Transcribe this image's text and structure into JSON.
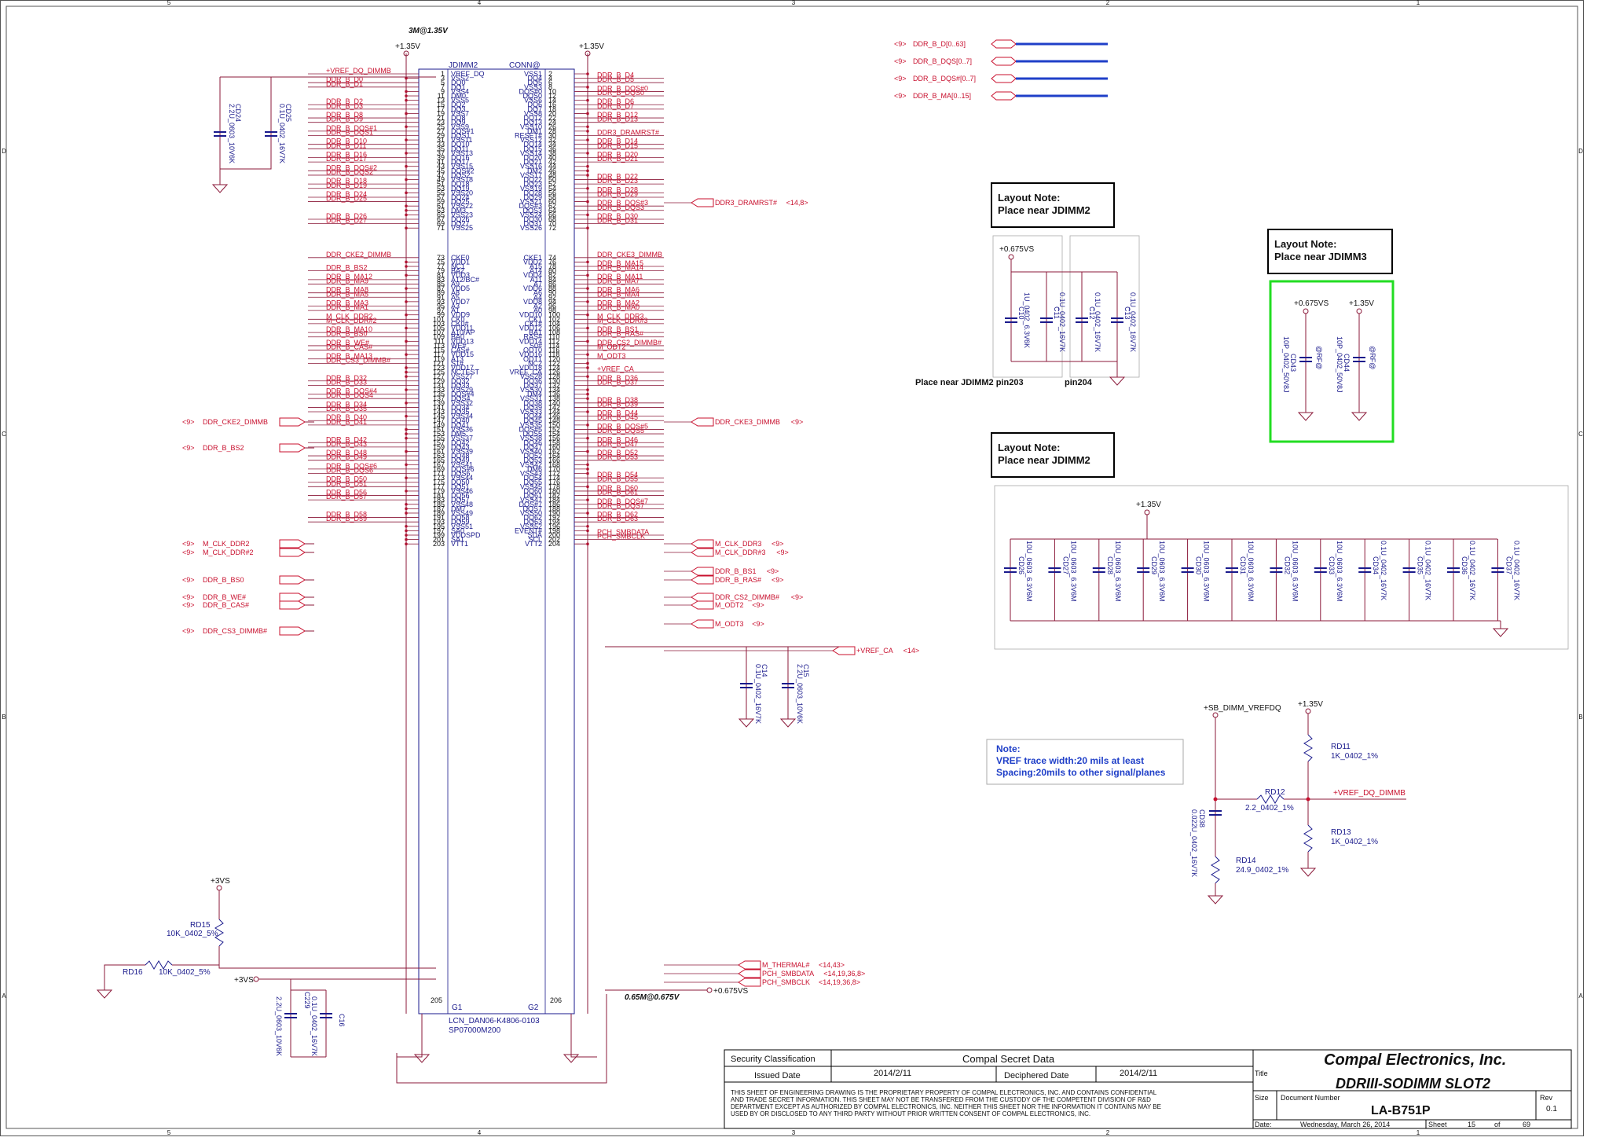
{
  "border": {
    "cols": [
      "5",
      "4",
      "3",
      "2",
      "1"
    ],
    "rows": [
      "D",
      "C",
      "B",
      "A"
    ]
  },
  "header_note": "3M@1.35V",
  "rails": {
    "p135": "+1.35V",
    "p0675vs": "+0.675VS",
    "p3vs": "+3VS",
    "sb_vrefdq": "+SB_DIMM_VREFDQ"
  },
  "connector": {
    "refdes": "JDIMM2",
    "type": "CONN@",
    "pn1": "LCN_DAN06-K4806-0103",
    "pn2": "SP07000M200",
    "g1": "G1",
    "g2": "G2",
    "left_pins": [
      [
        "1",
        "VREF_DQ",
        "+VREF_DQ_DIMMB"
      ],
      [
        "3",
        "VSS2",
        ""
      ],
      [
        "5",
        "DQ0",
        "DDR_B_D0"
      ],
      [
        "7",
        "DQ1",
        "DDR_B_D1"
      ],
      [
        "9",
        "VSS4",
        ""
      ],
      [
        "11",
        "DM0",
        ""
      ],
      [
        "13",
        "VSS5",
        ""
      ],
      [
        "15",
        "DQ2",
        "DDR_B_D2"
      ],
      [
        "17",
        "DQ3",
        "DDR_B_D3"
      ],
      [
        "19",
        "VSS7",
        ""
      ],
      [
        "21",
        "DQ8",
        "DDR_B_D8"
      ],
      [
        "23",
        "DQ9",
        "DDR_B_D9"
      ],
      [
        "25",
        "VSS9",
        ""
      ],
      [
        "27",
        "DQS#1",
        "DDR_B_DQS#1"
      ],
      [
        "29",
        "DQS1",
        "DDR_B_DQS1"
      ],
      [
        "31",
        "VSS11",
        ""
      ],
      [
        "33",
        "DQ10",
        "DDR_B_D10"
      ],
      [
        "35",
        "DQ11",
        "DDR_B_D11"
      ],
      [
        "37",
        "VSS13",
        ""
      ],
      [
        "39",
        "DQ16",
        "DDR_B_D16"
      ],
      [
        "41",
        "DQ17",
        "DDR_B_D17"
      ],
      [
        "43",
        "VSS15",
        ""
      ],
      [
        "45",
        "DQS#2",
        "DDR_B_DQS#2"
      ],
      [
        "47",
        "DQS2",
        "DDR_B_DQS2"
      ],
      [
        "49",
        "VSS18",
        ""
      ],
      [
        "51",
        "DQ18",
        "DDR_B_D18"
      ],
      [
        "53",
        "DQ19",
        "DDR_B_D19"
      ],
      [
        "55",
        "VSS20",
        ""
      ],
      [
        "57",
        "DQ24",
        "DDR_B_D24"
      ],
      [
        "59",
        "DQ25",
        "DDR_B_D25"
      ],
      [
        "61",
        "VSS22",
        ""
      ],
      [
        "63",
        "DM3",
        ""
      ],
      [
        "65",
        "VSS23",
        ""
      ],
      [
        "67",
        "DQ26",
        "DDR_B_D26"
      ],
      [
        "69",
        "DQ27",
        "DDR_B_D27"
      ],
      [
        "71",
        "VSS25",
        ""
      ],
      [
        "73",
        "CKE0",
        "DDR_CKE2_DIMMB"
      ],
      [
        "75",
        "VDD1",
        ""
      ],
      [
        "77",
        "NC1",
        ""
      ],
      [
        "79",
        "BA2",
        "DDR_B_BS2"
      ],
      [
        "81",
        "VDD3",
        ""
      ],
      [
        "83",
        "A12/BC#",
        "DDR_B_MA12"
      ],
      [
        "85",
        "A9",
        "DDR_B_MA9"
      ],
      [
        "87",
        "VDD5",
        ""
      ],
      [
        "89",
        "A8",
        "DDR_B_MA8"
      ],
      [
        "91",
        "A5",
        "DDR_B_MA5"
      ],
      [
        "93",
        "VDD7",
        ""
      ],
      [
        "95",
        "A3",
        "DDR_B_MA3"
      ],
      [
        "97",
        "A1",
        "DDR_B_MA1"
      ],
      [
        "99",
        "VDD9",
        ""
      ],
      [
        "101",
        "CK0",
        "M_CLK_DDR2"
      ],
      [
        "103",
        "CK0#",
        "M_CLK_DDR#2"
      ],
      [
        "105",
        "VDD11",
        ""
      ],
      [
        "107",
        "A10/AP",
        "DDR_B_MA10"
      ],
      [
        "109",
        "BA0",
        "DDR_B_BS0"
      ],
      [
        "111",
        "VDD13",
        ""
      ],
      [
        "113",
        "WE#",
        "DDR_B_WE#"
      ],
      [
        "115",
        "CAS#",
        "DDR_B_CAS#"
      ],
      [
        "117",
        "VDD15",
        ""
      ],
      [
        "119",
        "A13",
        "DDR_B_MA13"
      ],
      [
        "121",
        "S1#",
        "DDR_CS3_DIMMB#"
      ],
      [
        "123",
        "VDD17",
        ""
      ],
      [
        "125",
        "NCTEST",
        ""
      ],
      [
        "127",
        "VSS27",
        ""
      ],
      [
        "129",
        "DQ32",
        "DDR_B_D32"
      ],
      [
        "131",
        "DQ33",
        "DDR_B_D33"
      ],
      [
        "133",
        "VSS29",
        ""
      ],
      [
        "135",
        "DQS#4",
        "DDR_B_DQS#4"
      ],
      [
        "137",
        "DQS4",
        "DDR_B_DQS4"
      ],
      [
        "139",
        "VSS32",
        ""
      ],
      [
        "141",
        "DQ34",
        "DDR_B_D34"
      ],
      [
        "143",
        "DQ35",
        "DDR_B_D35"
      ],
      [
        "145",
        "VSS34",
        ""
      ],
      [
        "147",
        "DQ40",
        "DDR_B_D40"
      ],
      [
        "149",
        "DQ41",
        "DDR_B_D41"
      ],
      [
        "151",
        "VSS36",
        ""
      ],
      [
        "153",
        "DM5",
        ""
      ],
      [
        "155",
        "VSS37",
        ""
      ],
      [
        "157",
        "DQ42",
        "DDR_B_D42"
      ],
      [
        "159",
        "DQ43",
        "DDR_B_D43"
      ],
      [
        "161",
        "VSS39",
        ""
      ],
      [
        "163",
        "DQ48",
        "DDR_B_D48"
      ],
      [
        "165",
        "DQ49",
        "DDR_B_D49"
      ],
      [
        "167",
        "VSS41",
        ""
      ],
      [
        "169",
        "DQS#6",
        "DDR_B_DQS#6"
      ],
      [
        "171",
        "DQS6",
        "DDR_B_DQS6"
      ],
      [
        "173",
        "VSS44",
        ""
      ],
      [
        "175",
        "DQ50",
        "DDR_B_D50"
      ],
      [
        "177",
        "DQ51",
        "DDR_B_D51"
      ],
      [
        "179",
        "VSS46",
        ""
      ],
      [
        "181",
        "DQ56",
        "DDR_B_D56"
      ],
      [
        "183",
        "DQ57",
        "DDR_B_D57"
      ],
      [
        "185",
        "VSS48",
        ""
      ],
      [
        "187",
        "DM7",
        ""
      ],
      [
        "189",
        "VSS49",
        ""
      ],
      [
        "191",
        "DQ58",
        "DDR_B_D58"
      ],
      [
        "193",
        "DQ59",
        "DDR_B_D59"
      ],
      [
        "195",
        "VSS51",
        ""
      ],
      [
        "197",
        "SA0",
        ""
      ],
      [
        "199",
        "VDDSPD",
        ""
      ],
      [
        "201",
        "SA1",
        ""
      ],
      [
        "203",
        "VTT1",
        ""
      ]
    ],
    "right_pins": [
      [
        "2",
        "VSS1",
        ""
      ],
      [
        "4",
        "DQ4",
        "DDR_B_D4"
      ],
      [
        "6",
        "DQ5",
        "DDR_B_D5"
      ],
      [
        "8",
        "VSS3",
        ""
      ],
      [
        "10",
        "DQS#0",
        "DDR_B_DQS#0"
      ],
      [
        "12",
        "DQS0",
        "DDR_B_DQS0"
      ],
      [
        "14",
        "VSS6",
        ""
      ],
      [
        "16",
        "DQ6",
        "DDR_B_D6"
      ],
      [
        "18",
        "DQ7",
        "DDR_B_D7"
      ],
      [
        "20",
        "VSS8",
        ""
      ],
      [
        "22",
        "DQ12",
        "DDR_B_D12"
      ],
      [
        "24",
        "DQ13",
        "DDR_B_D13"
      ],
      [
        "26",
        "VSS10",
        ""
      ],
      [
        "28",
        "DM1",
        ""
      ],
      [
        "30",
        "RESET#",
        "DDR3_DRAMRST#"
      ],
      [
        "32",
        "VSS12",
        ""
      ],
      [
        "34",
        "DQ14",
        "DDR_B_D14"
      ],
      [
        "36",
        "DQ15",
        "DDR_B_D15"
      ],
      [
        "38",
        "VSS14",
        ""
      ],
      [
        "40",
        "DQ20",
        "DDR_B_D20"
      ],
      [
        "42",
        "DQ21",
        "DDR_B_D21"
      ],
      [
        "44",
        "VSS16",
        ""
      ],
      [
        "46",
        "DM2",
        ""
      ],
      [
        "48",
        "VSS17",
        ""
      ],
      [
        "50",
        "DQ22",
        "DDR_B_D22"
      ],
      [
        "52",
        "DQ23",
        "DDR_B_D23"
      ],
      [
        "54",
        "VSS19",
        ""
      ],
      [
        "56",
        "DQ28",
        "DDR_B_D28"
      ],
      [
        "58",
        "DQ29",
        "DDR_B_D29"
      ],
      [
        "60",
        "VSS21",
        ""
      ],
      [
        "62",
        "DQS#3",
        "DDR_B_DQS#3"
      ],
      [
        "64",
        "DQS3",
        "DDR_B_DQS3"
      ],
      [
        "66",
        "VSS24",
        ""
      ],
      [
        "68",
        "DQ30",
        "DDR_B_D30"
      ],
      [
        "70",
        "DQ31",
        "DDR_B_D31"
      ],
      [
        "72",
        "VSS26",
        ""
      ],
      [
        "74",
        "CKE1",
        "DDR_CKE3_DIMMB"
      ],
      [
        "76",
        "VDD2",
        ""
      ],
      [
        "78",
        "A15",
        "DDR_B_MA15"
      ],
      [
        "80",
        "A14",
        "DDR_B_MA14"
      ],
      [
        "82",
        "VDD4",
        ""
      ],
      [
        "84",
        "A11",
        "DDR_B_MA11"
      ],
      [
        "86",
        "A7",
        "DDR_B_MA7"
      ],
      [
        "88",
        "VDD6",
        ""
      ],
      [
        "90",
        "A6",
        "DDR_B_MA6"
      ],
      [
        "92",
        "A4",
        "DDR_B_MA4"
      ],
      [
        "94",
        "VDD8",
        ""
      ],
      [
        "96",
        "A2",
        "DDR_B_MA2"
      ],
      [
        "98",
        "A0",
        "DDR_B_MA0"
      ],
      [
        "100",
        "VDD10",
        ""
      ],
      [
        "102",
        "CK1",
        "M_CLK_DDR3"
      ],
      [
        "104",
        "CK1#",
        "M_CLK_DDR#3"
      ],
      [
        "106",
        "VDD12",
        ""
      ],
      [
        "108",
        "BA1",
        "DDR_B_BS1"
      ],
      [
        "110",
        "RAS#",
        "DDR_B_RAS#"
      ],
      [
        "112",
        "VDD14",
        ""
      ],
      [
        "114",
        "S0#",
        "DDR_CS2_DIMMB#"
      ],
      [
        "116",
        "ODT0",
        "M_ODT2"
      ],
      [
        "118",
        "VDD16",
        ""
      ],
      [
        "120",
        "ODT1",
        "M_ODT3"
      ],
      [
        "122",
        "NC2",
        ""
      ],
      [
        "124",
        "VDD18",
        ""
      ],
      [
        "126",
        "VREF_CA",
        "+VREF_CA"
      ],
      [
        "128",
        "VSS28",
        ""
      ],
      [
        "130",
        "DQ36",
        "DDR_B_D36"
      ],
      [
        "132",
        "DQ37",
        "DDR_B_D37"
      ],
      [
        "134",
        "VSS30",
        ""
      ],
      [
        "136",
        "DM4",
        ""
      ],
      [
        "138",
        "VSS31",
        ""
      ],
      [
        "140",
        "DQ38",
        "DDR_B_D38"
      ],
      [
        "142",
        "DQ39",
        "DDR_B_D39"
      ],
      [
        "144",
        "VSS33",
        ""
      ],
      [
        "146",
        "DQ44",
        "DDR_B_D44"
      ],
      [
        "148",
        "DQ45",
        "DDR_B_D45"
      ],
      [
        "150",
        "VSS35",
        ""
      ],
      [
        "152",
        "DQS#5",
        "DDR_B_DQS#5"
      ],
      [
        "154",
        "DQS5",
        "DDR_B_DQS5"
      ],
      [
        "156",
        "VSS38",
        ""
      ],
      [
        "158",
        "DQ46",
        "DDR_B_D46"
      ],
      [
        "160",
        "DQ47",
        "DDR_B_D47"
      ],
      [
        "162",
        "VSS40",
        ""
      ],
      [
        "164",
        "DQ52",
        "DDR_B_D52"
      ],
      [
        "166",
        "DQ53",
        "DDR_B_D53"
      ],
      [
        "168",
        "VSS42",
        ""
      ],
      [
        "170",
        "DM6",
        ""
      ],
      [
        "172",
        "VSS43",
        ""
      ],
      [
        "174",
        "DQ54",
        "DDR_B_D54"
      ],
      [
        "176",
        "DQ55",
        "DDR_B_D55"
      ],
      [
        "178",
        "VSS45",
        ""
      ],
      [
        "180",
        "DQ60",
        "DDR_B_D60"
      ],
      [
        "182",
        "DQ61",
        "DDR_B_D61"
      ],
      [
        "184",
        "VSS47",
        ""
      ],
      [
        "186",
        "DQS#7",
        "DDR_B_DQS#7"
      ],
      [
        "188",
        "DQS7",
        "DDR_B_DQS7"
      ],
      [
        "190",
        "VSS50",
        ""
      ],
      [
        "192",
        "DQ62",
        "DDR_B_D62"
      ],
      [
        "194",
        "DQ63",
        "DDR_B_D63"
      ],
      [
        "196",
        "VSS52",
        ""
      ],
      [
        "198",
        "EVENT#",
        ""
      ],
      [
        "200",
        "SDA",
        "PCH_SMBDATA"
      ],
      [
        "202",
        "SCL",
        "PCH_SMBCLK"
      ],
      [
        "204",
        "VTT2",
        ""
      ]
    ],
    "pin205": "205",
    "pin206": "206"
  },
  "offpage_left": [
    {
      "ref": "<9>",
      "name": "DDR_CKE2_DIMMB"
    },
    {
      "ref": "<9>",
      "name": "DDR_B_BS2"
    },
    {
      "ref": "<9>",
      "name": "M_CLK_DDR2"
    },
    {
      "ref": "<9>",
      "name": "M_CLK_DDR#2"
    },
    {
      "ref": "<9>",
      "name": "DDR_B_BS0"
    },
    {
      "ref": "<9>",
      "name": "DDR_B_WE#"
    },
    {
      "ref": "<9>",
      "name": "DDR_B_CAS#"
    },
    {
      "ref": "<9>",
      "name": "DDR_CS3_DIMMB#"
    }
  ],
  "offpage_right": [
    {
      "name": "DDR3_DRAMRST#",
      "ref": "<14,8>"
    },
    {
      "name": "DDR_CKE3_DIMMB",
      "ref": "<9>"
    },
    {
      "name": "M_CLK_DDR3",
      "ref": "<9>"
    },
    {
      "name": "M_CLK_DDR#3",
      "ref": "<9>"
    },
    {
      "name": "DDR_B_BS1",
      "ref": "<9>"
    },
    {
      "name": "DDR_B_RAS#",
      "ref": "<9>"
    },
    {
      "name": "DDR_CS2_DIMMB#",
      "ref": "<9>"
    },
    {
      "name": "M_ODT2",
      "ref": "<9>"
    },
    {
      "name": "M_ODT3",
      "ref": "<9>"
    },
    {
      "name": "+VREF_CA",
      "ref": "<14>"
    },
    {
      "name": "M_THERMAL#",
      "ref": "<14,43>"
    },
    {
      "name": "PCH_SMBDATA",
      "ref": "<14,19,36,8>"
    },
    {
      "name": "PCH_SMBCLK",
      "ref": "<14,19,36,8>"
    }
  ],
  "buses": [
    {
      "ref": "<9>",
      "name": "DDR_B_D[0..63]"
    },
    {
      "ref": "<9>",
      "name": "DDR_B_DQS[0..7]"
    },
    {
      "ref": "<9>",
      "name": "DDR_B_DQS#[0..7]"
    },
    {
      "ref": "<9>",
      "name": "DDR_B_MA[0..15]"
    }
  ],
  "caps_vref": [
    {
      "ref": "CD24",
      "val": "2.2U_0603_10V6K"
    },
    {
      "ref": "CD25",
      "val": "0.1U_0402_16V7K"
    }
  ],
  "caps_vrefca": [
    {
      "ref": "C14",
      "val": "0.1U_0402_16V7K"
    },
    {
      "ref": "C15",
      "val": "2.2U_0603_10V6K"
    }
  ],
  "caps_spd": [
    {
      "ref": "C229",
      "val": "2.2U_0603_10V6K"
    },
    {
      "ref": "C16",
      "val": "0.1U_0402_16V7K"
    }
  ],
  "res_spd": {
    "rd15_ref": "RD15",
    "rd15_val": "10K_0402_5%",
    "rd16_ref": "RD16",
    "rd16_val": "10K_0402_5%"
  },
  "vtt_label": "0.65M@0.675V",
  "vtt_rail": "+0.675VS",
  "layout_note1": {
    "line1": "Layout Note:",
    "line2": "Place near JDIMM2"
  },
  "layout_note2": {
    "line1": "Layout Note:",
    "line2": "Place near JDIMM3"
  },
  "layout_note3": {
    "line1": "Layout Note:",
    "line2": "Place near JDIMM2"
  },
  "vtt_caps": [
    {
      "ref": "C10",
      "val": "1U_0402_6.3V6K"
    },
    {
      "ref": "C11",
      "val": "0.1U_0402_16V7K"
    },
    {
      "ref": "C12",
      "val": "0.1U_0402_16V7K"
    },
    {
      "ref": "C13",
      "val": "0.1U_0402_16V7K"
    }
  ],
  "vtt_caps_note": "Place near JDIMM2 pin203",
  "vtt_caps_note2": "pin204",
  "jdimm3_caps": [
    {
      "ref": "CD43",
      "val": "10P_0402_50V8J",
      "opt": "@RF@"
    },
    {
      "ref": "CD44",
      "val": "10P_0402_50V8J",
      "opt": "@RF@"
    }
  ],
  "bulk_caps": [
    {
      "ref": "CD26",
      "val": "10U_0603_6.3V6M"
    },
    {
      "ref": "CD27",
      "val": "10U_0603_6.3V6M"
    },
    {
      "ref": "CD28",
      "val": "10U_0603_6.3V6M"
    },
    {
      "ref": "CD29",
      "val": "10U_0603_6.3V6M"
    },
    {
      "ref": "CD30",
      "val": "10U_0603_6.3V6M"
    },
    {
      "ref": "CD31",
      "val": "10U_0603_6.3V6M"
    },
    {
      "ref": "CD32",
      "val": "10U_0603_6.3V6M"
    },
    {
      "ref": "CD33",
      "val": "10U_0603_6.3V6M"
    },
    {
      "ref": "CD34",
      "val": "0.1U_0402_16V7K"
    },
    {
      "ref": "CD35",
      "val": "0.1U_0402_16V7K"
    },
    {
      "ref": "CD36",
      "val": "0.1U_0402_16V7K"
    },
    {
      "ref": "CD37",
      "val": "0.1U_0402_16V7K"
    }
  ],
  "note": {
    "title": "Note:",
    "line1": "VREF trace width:20 mils at least",
    "line2": "Spacing:20mils to other signal/planes"
  },
  "vref_circuit": {
    "rd11_ref": "RD11",
    "rd11_val": "1K_0402_1%",
    "rd12_ref": "RD12",
    "rd12_val": "2.2_0402_1%",
    "rd13_ref": "RD13",
    "rd13_val": "1K_0402_1%",
    "rd14_ref": "RD14",
    "rd14_val": "24.9_0402_1%",
    "cd38_ref": "CD38",
    "cd38_val": "0.022U_0402_16V7K",
    "out_net": "+VREF_DQ_DIMMB"
  },
  "title_block": {
    "sec_label": "Security Classification",
    "sec_value": "Compal Secret Data",
    "issued_label": "Issued Date",
    "issued_value": "2014/2/11",
    "deciph_label": "Deciphered Date",
    "deciph_value": "2014/2/11",
    "notice": "THIS SHEET OF ENGINEERING DRAWING IS THE PROPRIETARY PROPERTY OF COMPAL ELECTRONICS, INC. AND CONTAINS CONFIDENTIAL AND TRADE SECRET INFORMATION. THIS SHEET MAY NOT BE TRANSFERED FROM THE CUSTODY OF THE COMPETENT DIVISION OF R&D DEPARTMENT EXCEPT AS AUTHORIZED BY COMPAL ELECTRONICS, INC. NEITHER THIS SHEET NOR THE INFORMATION IT CONTAINS MAY BE USED BY OR DISCLOSED TO ANY THIRD PARTY WITHOUT PRIOR WRITTEN CONSENT OF COMPAL ELECTRONICS, INC.",
    "company": "Compal Electronics, Inc.",
    "title_label": "Title",
    "title": "DDRIII-SODIMM SLOT2",
    "size_label": "Size",
    "docnum_label": "Document Number",
    "docnum": "LA-B751P",
    "rev_label": "Rev",
    "rev": "0.1",
    "date_label": "Date:",
    "date": "Wednesday, March 26, 2014",
    "sheet_label": "Sheet",
    "sheet": "15",
    "of_label": "of",
    "total": "69"
  }
}
